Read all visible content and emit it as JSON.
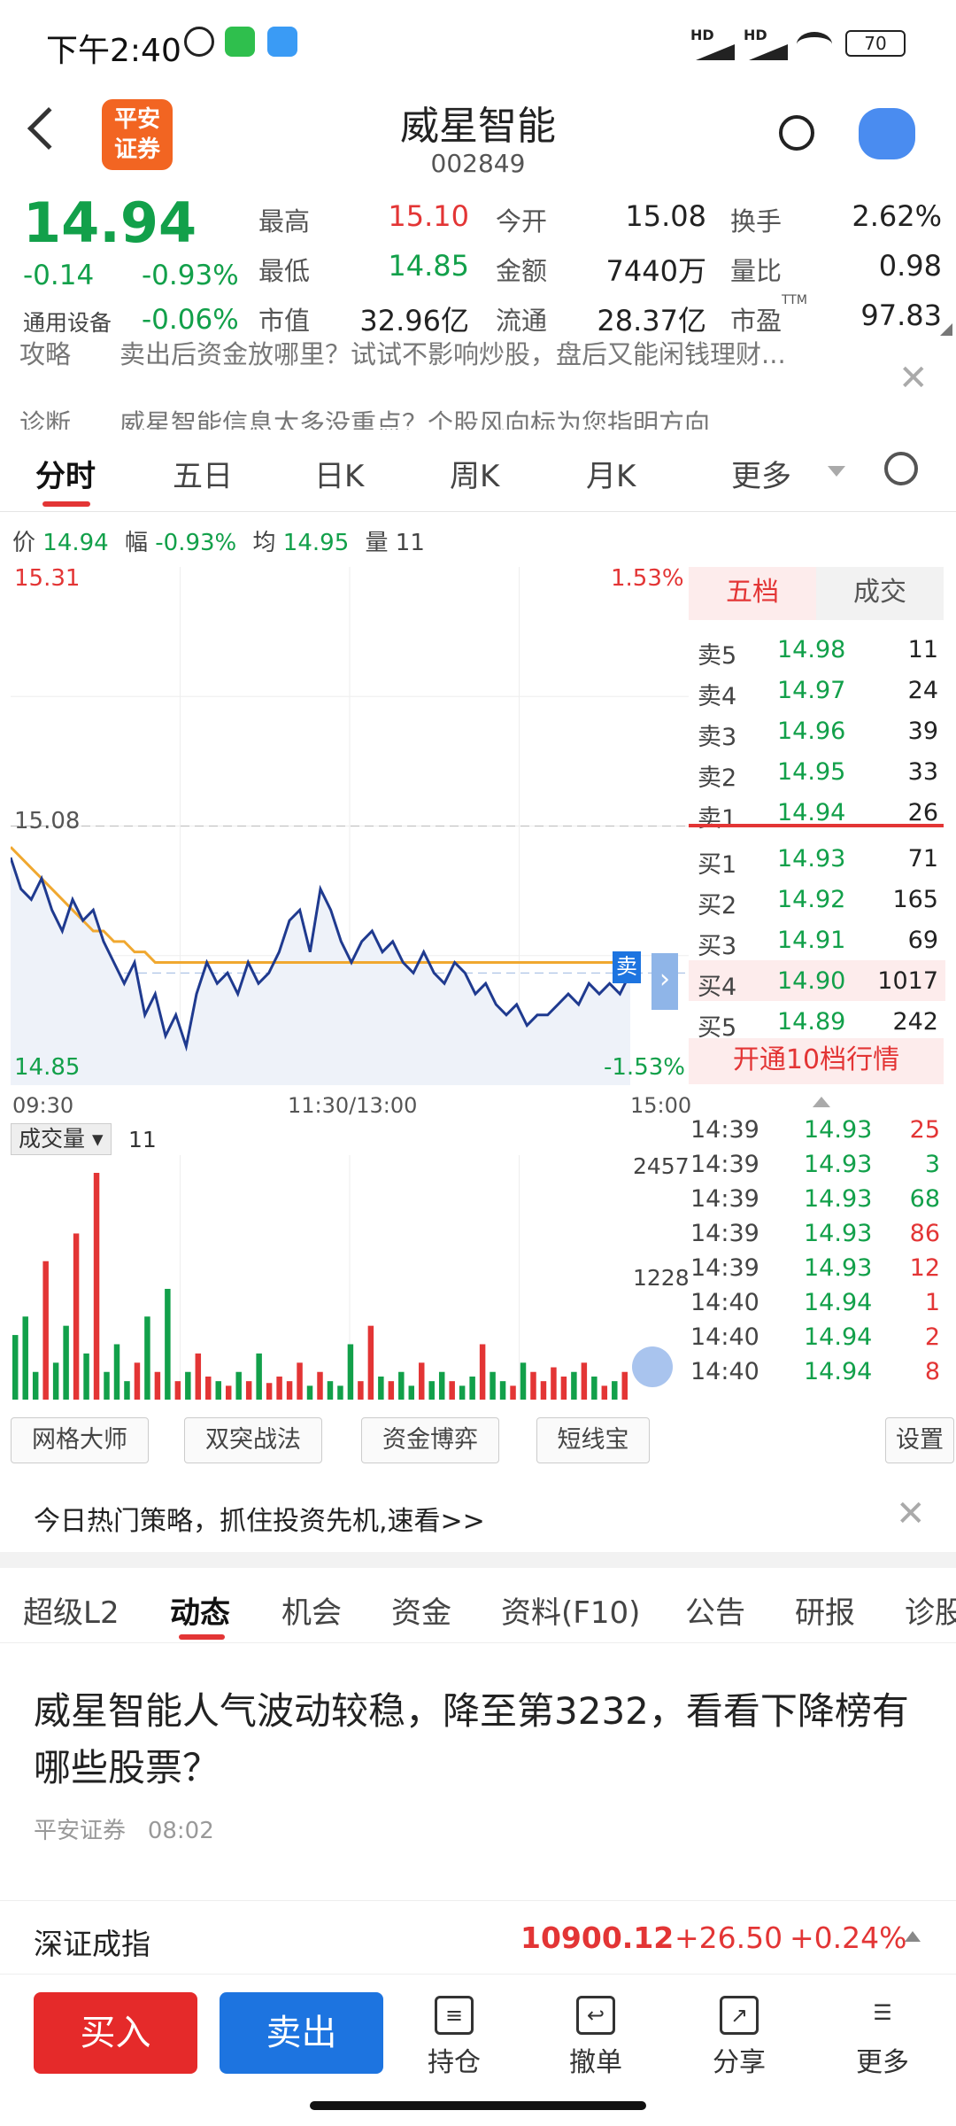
{
  "status": {
    "time": "下午2:40",
    "net1": "HD",
    "net2": "HD",
    "battery": "70"
  },
  "header": {
    "logo": "平安\n证券",
    "logo_line1": "平安",
    "logo_line2": "证券",
    "name": "威星智能",
    "code": "002849"
  },
  "quote": {
    "price": "14.94",
    "change": "-0.14",
    "change_pct": "-0.93%",
    "sector": "通用设备",
    "sector_pct": "-0.06%",
    "items": [
      {
        "label": "最高",
        "value": "15.10",
        "color": "red"
      },
      {
        "label": "今开",
        "value": "15.08",
        "color": "black"
      },
      {
        "label": "换手",
        "value": "2.62%",
        "color": "black"
      },
      {
        "label": "最低",
        "value": "14.85",
        "color": "green"
      },
      {
        "label": "金额",
        "value": "7440万",
        "color": "black"
      },
      {
        "label": "量比",
        "value": "0.98",
        "color": "black"
      },
      {
        "label": "市值",
        "value": "32.96亿",
        "color": "black"
      },
      {
        "label": "流通",
        "value": "28.37亿",
        "color": "black"
      },
      {
        "label": "市盈",
        "value": "97.83",
        "color": "black",
        "sup": "TTM"
      }
    ]
  },
  "banner": {
    "line1_tag": "攻略",
    "line1": "卖出后资金放哪里？试试不影响炒股，盘后又能闲钱理财...",
    "line2_tag": "诊断",
    "line2": "威星智能信息太多没重点？个股风向标为您指明方向"
  },
  "chart_tabs": [
    "分时",
    "五日",
    "日K",
    "周K",
    "月K",
    "更多"
  ],
  "infoline": {
    "price_label": "价",
    "price": "14.94",
    "amp_label": "幅",
    "amp": "-0.93%",
    "avg_label": "均",
    "avg": "14.95",
    "vol_label": "量",
    "vol": "11"
  },
  "chart_labels": {
    "high": "15.31",
    "high_pct": "1.53%",
    "prev_close": "15.08",
    "low": "14.85",
    "low_pct": "-1.53%",
    "t_start": "09:30",
    "t_mid": "11:30/13:00",
    "t_end": "15:00",
    "sell_tag": "卖",
    "vol_label": "成交量",
    "vol_value": "11",
    "vol_max": "2457",
    "vol_mid": "1228"
  },
  "orderbook": {
    "tab_active": "五档",
    "tab_other": "成交",
    "asks": [
      {
        "label": "卖5",
        "price": "14.98",
        "vol": "11"
      },
      {
        "label": "卖4",
        "price": "14.97",
        "vol": "24"
      },
      {
        "label": "卖3",
        "price": "14.96",
        "vol": "39"
      },
      {
        "label": "卖2",
        "price": "14.95",
        "vol": "33"
      },
      {
        "label": "卖1",
        "price": "14.94",
        "vol": "26"
      }
    ],
    "bids": [
      {
        "label": "买1",
        "price": "14.93",
        "vol": "71"
      },
      {
        "label": "买2",
        "price": "14.92",
        "vol": "165"
      },
      {
        "label": "买3",
        "price": "14.91",
        "vol": "69"
      },
      {
        "label": "买4",
        "price": "14.90",
        "vol": "1017"
      },
      {
        "label": "买5",
        "price": "14.89",
        "vol": "242"
      }
    ],
    "upgrade": "开通10档行情"
  },
  "ticks": [
    {
      "time": "14:39",
      "price": "14.93",
      "vol": "25",
      "color": "red"
    },
    {
      "time": "14:39",
      "price": "14.93",
      "vol": "3",
      "color": "green"
    },
    {
      "time": "14:39",
      "price": "14.93",
      "vol": "68",
      "color": "green"
    },
    {
      "time": "14:39",
      "price": "14.93",
      "vol": "86",
      "color": "red"
    },
    {
      "time": "14:39",
      "price": "14.93",
      "vol": "12",
      "color": "red"
    },
    {
      "time": "14:40",
      "price": "14.94",
      "vol": "1",
      "color": "red"
    },
    {
      "time": "14:40",
      "price": "14.94",
      "vol": "2",
      "color": "red"
    },
    {
      "time": "14:40",
      "price": "14.94",
      "vol": "8",
      "color": "red"
    }
  ],
  "tools": [
    "网格大师",
    "双突战法",
    "资金博弈",
    "短线宝",
    "设置"
  ],
  "promo": "今日热门策略，抓住投资先机,速看>>",
  "info_tabs": [
    "超级L2",
    "动态",
    "机会",
    "资金",
    "资料(F10)",
    "公告",
    "研报",
    "诊股"
  ],
  "news": {
    "title": "威星智能人气波动较稳，降至第3232，看看下降榜有哪些股票？",
    "source": "平安证券",
    "time": "08:02"
  },
  "index": {
    "name": "深证成指",
    "value": "10900.12",
    "change": "+26.50",
    "pct": "+0.24%"
  },
  "bottom": {
    "buy": "买入",
    "sell": "卖出",
    "hold": "持仓",
    "cancel": "撤单",
    "share": "分享",
    "more": "更多"
  },
  "colors": {
    "red": "#e33535",
    "green": "#12a04a",
    "blue": "#1d74e0",
    "price_line": "#1f3a8f",
    "avg_line": "#f0a830"
  },
  "chart_data": {
    "type": "line",
    "x_range": [
      "09:30",
      "15:00"
    ],
    "ylim": [
      14.85,
      15.31
    ],
    "prev_close": 15.08,
    "price": [
      15.05,
      15.02,
      15.01,
      15.03,
      15.0,
      14.98,
      15.01,
      14.99,
      15.0,
      14.97,
      14.95,
      14.93,
      14.95,
      14.9,
      14.92,
      14.88,
      14.9,
      14.87,
      14.92,
      14.95,
      14.93,
      14.94,
      14.92,
      14.95,
      14.93,
      14.94,
      14.96,
      14.99,
      15.0,
      14.96,
      15.02,
      15.0,
      14.97,
      14.95,
      14.97,
      14.98,
      14.96,
      14.97,
      14.95,
      14.94,
      14.96,
      14.94,
      14.93,
      14.95,
      14.94,
      14.92,
      14.93,
      14.91,
      14.9,
      14.91,
      14.89,
      14.9,
      14.9,
      14.91,
      14.92,
      14.91,
      14.93,
      14.92,
      14.93,
      14.92,
      14.94
    ],
    "avg": [
      15.06,
      15.05,
      15.04,
      15.03,
      15.02,
      15.01,
      15.0,
      14.99,
      14.98,
      14.98,
      14.97,
      14.97,
      14.96,
      14.96,
      14.95,
      14.95,
      14.95,
      14.95,
      14.95,
      14.95,
      14.95,
      14.95,
      14.95,
      14.95,
      14.95,
      14.95,
      14.95,
      14.95,
      14.95,
      14.95,
      14.95,
      14.95,
      14.95,
      14.95,
      14.95,
      14.95,
      14.95,
      14.95,
      14.95,
      14.95,
      14.95,
      14.95,
      14.95,
      14.95,
      14.95,
      14.95,
      14.95,
      14.95,
      14.95,
      14.95,
      14.95,
      14.95,
      14.95,
      14.95,
      14.95,
      14.95,
      14.95,
      14.95,
      14.95,
      14.95,
      14.95
    ],
    "volume": [
      700,
      900,
      300,
      1500,
      400,
      800,
      1800,
      500,
      2457,
      300,
      600,
      200,
      400,
      900,
      300,
      1200,
      200,
      300,
      500,
      250,
      200,
      150,
      300,
      200,
      500,
      180,
      250,
      200,
      400,
      150,
      300,
      200,
      150,
      600,
      200,
      800,
      250,
      200,
      300,
      150,
      400,
      200,
      300,
      200,
      150,
      250,
      600,
      300,
      200,
      150,
      400,
      300,
      200,
      350,
      250,
      300,
      400,
      250,
      150,
      200,
      300
    ]
  }
}
